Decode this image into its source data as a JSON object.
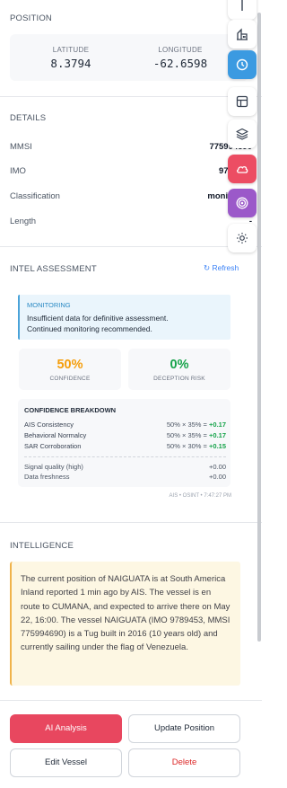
{
  "position": {
    "title": "POSITION",
    "latitude_label": "LATITUDE",
    "latitude": "8.3794",
    "longitude_label": "LONGITUDE",
    "longitude": "-62.6598"
  },
  "details": {
    "title": "DETAILS",
    "rows": [
      {
        "label": "MMSI",
        "value": "775994690"
      },
      {
        "label": "IMO",
        "value": "9789453"
      },
      {
        "label": "Classification",
        "value": "monitoring"
      },
      {
        "label": "Length",
        "value": "-"
      }
    ]
  },
  "intel": {
    "title": "INTEL ASSESSMENT",
    "refresh": "↻ Refresh",
    "status_title": "MONITORING",
    "status_line1": "Insufficient data for definitive assessment.",
    "status_line2": "Continued monitoring recommended.",
    "confidence": "50%",
    "confidence_label": "CONFIDENCE",
    "deception": "0%",
    "deception_label": "DECEPTION RISK",
    "breakdown_title": "CONFIDENCE BREAKDOWN",
    "breakdown": [
      {
        "label": "AIS Consistency",
        "formula": "50% × 35% = ",
        "result": "+0.17"
      },
      {
        "label": "Behavioral Normalcy",
        "formula": "50% × 35% = ",
        "result": "+0.17"
      },
      {
        "label": "SAR Corroboration",
        "formula": "50% × 30% = ",
        "result": "+0.15"
      }
    ],
    "adjustments": [
      {
        "label": "Signal quality (high)",
        "value": "+0.00"
      },
      {
        "label": "Data freshness",
        "value": "+0.00"
      }
    ],
    "source": "AIS • OSINT • 7:47:27 PM"
  },
  "intelligence": {
    "title": "INTELLIGENCE",
    "text": "The current position of NAIGUATA is at South America Inland reported 1 min ago by AIS. The vessel is en route to CUMANA, and expected to arrive there on May 22, 16:00. The vessel NAIGUATA (IMO 9789453, MMSI 775994690) is a Tug built in 2016 (10 years old) and currently sailing under the flag of Venezuela."
  },
  "actions": {
    "ai_analysis": "AI Analysis",
    "update_position": "Update Position",
    "edit_vessel": "Edit Vessel",
    "delete": "Delete"
  },
  "colors": {
    "accent": "#e8475f",
    "confidence": "#f59e0b",
    "deception": "#16a34a",
    "rail_active_blue": "#3b9ae1",
    "rail_active_red": "#ec4d63",
    "rail_active_purple": "#9b59c9"
  },
  "rail": [
    {
      "icon": "pin-icon",
      "active": false
    },
    {
      "icon": "building-icon",
      "active": false
    },
    {
      "icon": "clock-icon",
      "active": true,
      "color": "#3b9ae1"
    },
    {
      "icon": "table-icon",
      "active": false
    },
    {
      "icon": "layers-icon",
      "active": false
    },
    {
      "icon": "cloud-icon",
      "active": true,
      "color": "#ec4d63"
    },
    {
      "icon": "target-icon",
      "active": true,
      "color": "#9b59c9"
    },
    {
      "icon": "sun-icon",
      "active": false
    }
  ]
}
